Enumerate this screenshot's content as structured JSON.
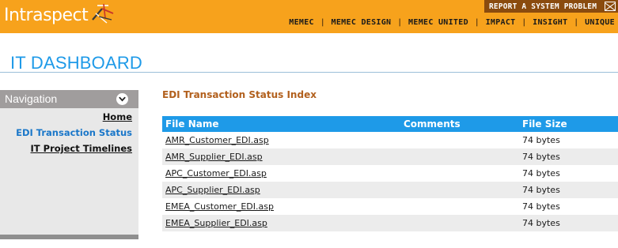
{
  "header": {
    "logo_text": "Intraspect",
    "report_label": "REPORT A SYSTEM PROBLEM",
    "report_icon": "mail-icon",
    "nav": [
      "MEMEC",
      "MEMEC DESIGN",
      "MEMEC UNITED",
      "IMPACT",
      "INSIGHT",
      "UNIQUE"
    ],
    "colors": {
      "bar": "#f7a21c",
      "report_bg": "#8a4b0e"
    }
  },
  "page": {
    "title": "IT DASHBOARD",
    "title_color": "#1e9ae8"
  },
  "sidebar": {
    "header": "Navigation",
    "toggle_icon": "chevron-down-icon",
    "items": [
      {
        "label": "Home",
        "active": false
      },
      {
        "label": "EDI Transaction Status",
        "active": true
      },
      {
        "label": "IT Project Timelines",
        "active": false
      }
    ]
  },
  "main": {
    "section_title": "EDI Transaction Status Index",
    "table": {
      "columns": [
        "File Name",
        "Comments",
        "File Size"
      ],
      "rows": [
        {
          "name": "AMR_Customer_EDI.asp",
          "comments": "",
          "size": "74 bytes"
        },
        {
          "name": "AMR_Supplier_EDI.asp",
          "comments": "",
          "size": "74 bytes"
        },
        {
          "name": "APC_Customer_EDI.asp",
          "comments": "",
          "size": "74 bytes"
        },
        {
          "name": "APC_Supplier_EDI.asp",
          "comments": "",
          "size": "74 bytes"
        },
        {
          "name": "EMEA_Customer_EDI.asp",
          "comments": "",
          "size": "74 bytes"
        },
        {
          "name": "EMEA_Supplier_EDI.asp",
          "comments": "",
          "size": "74 bytes"
        }
      ]
    }
  }
}
